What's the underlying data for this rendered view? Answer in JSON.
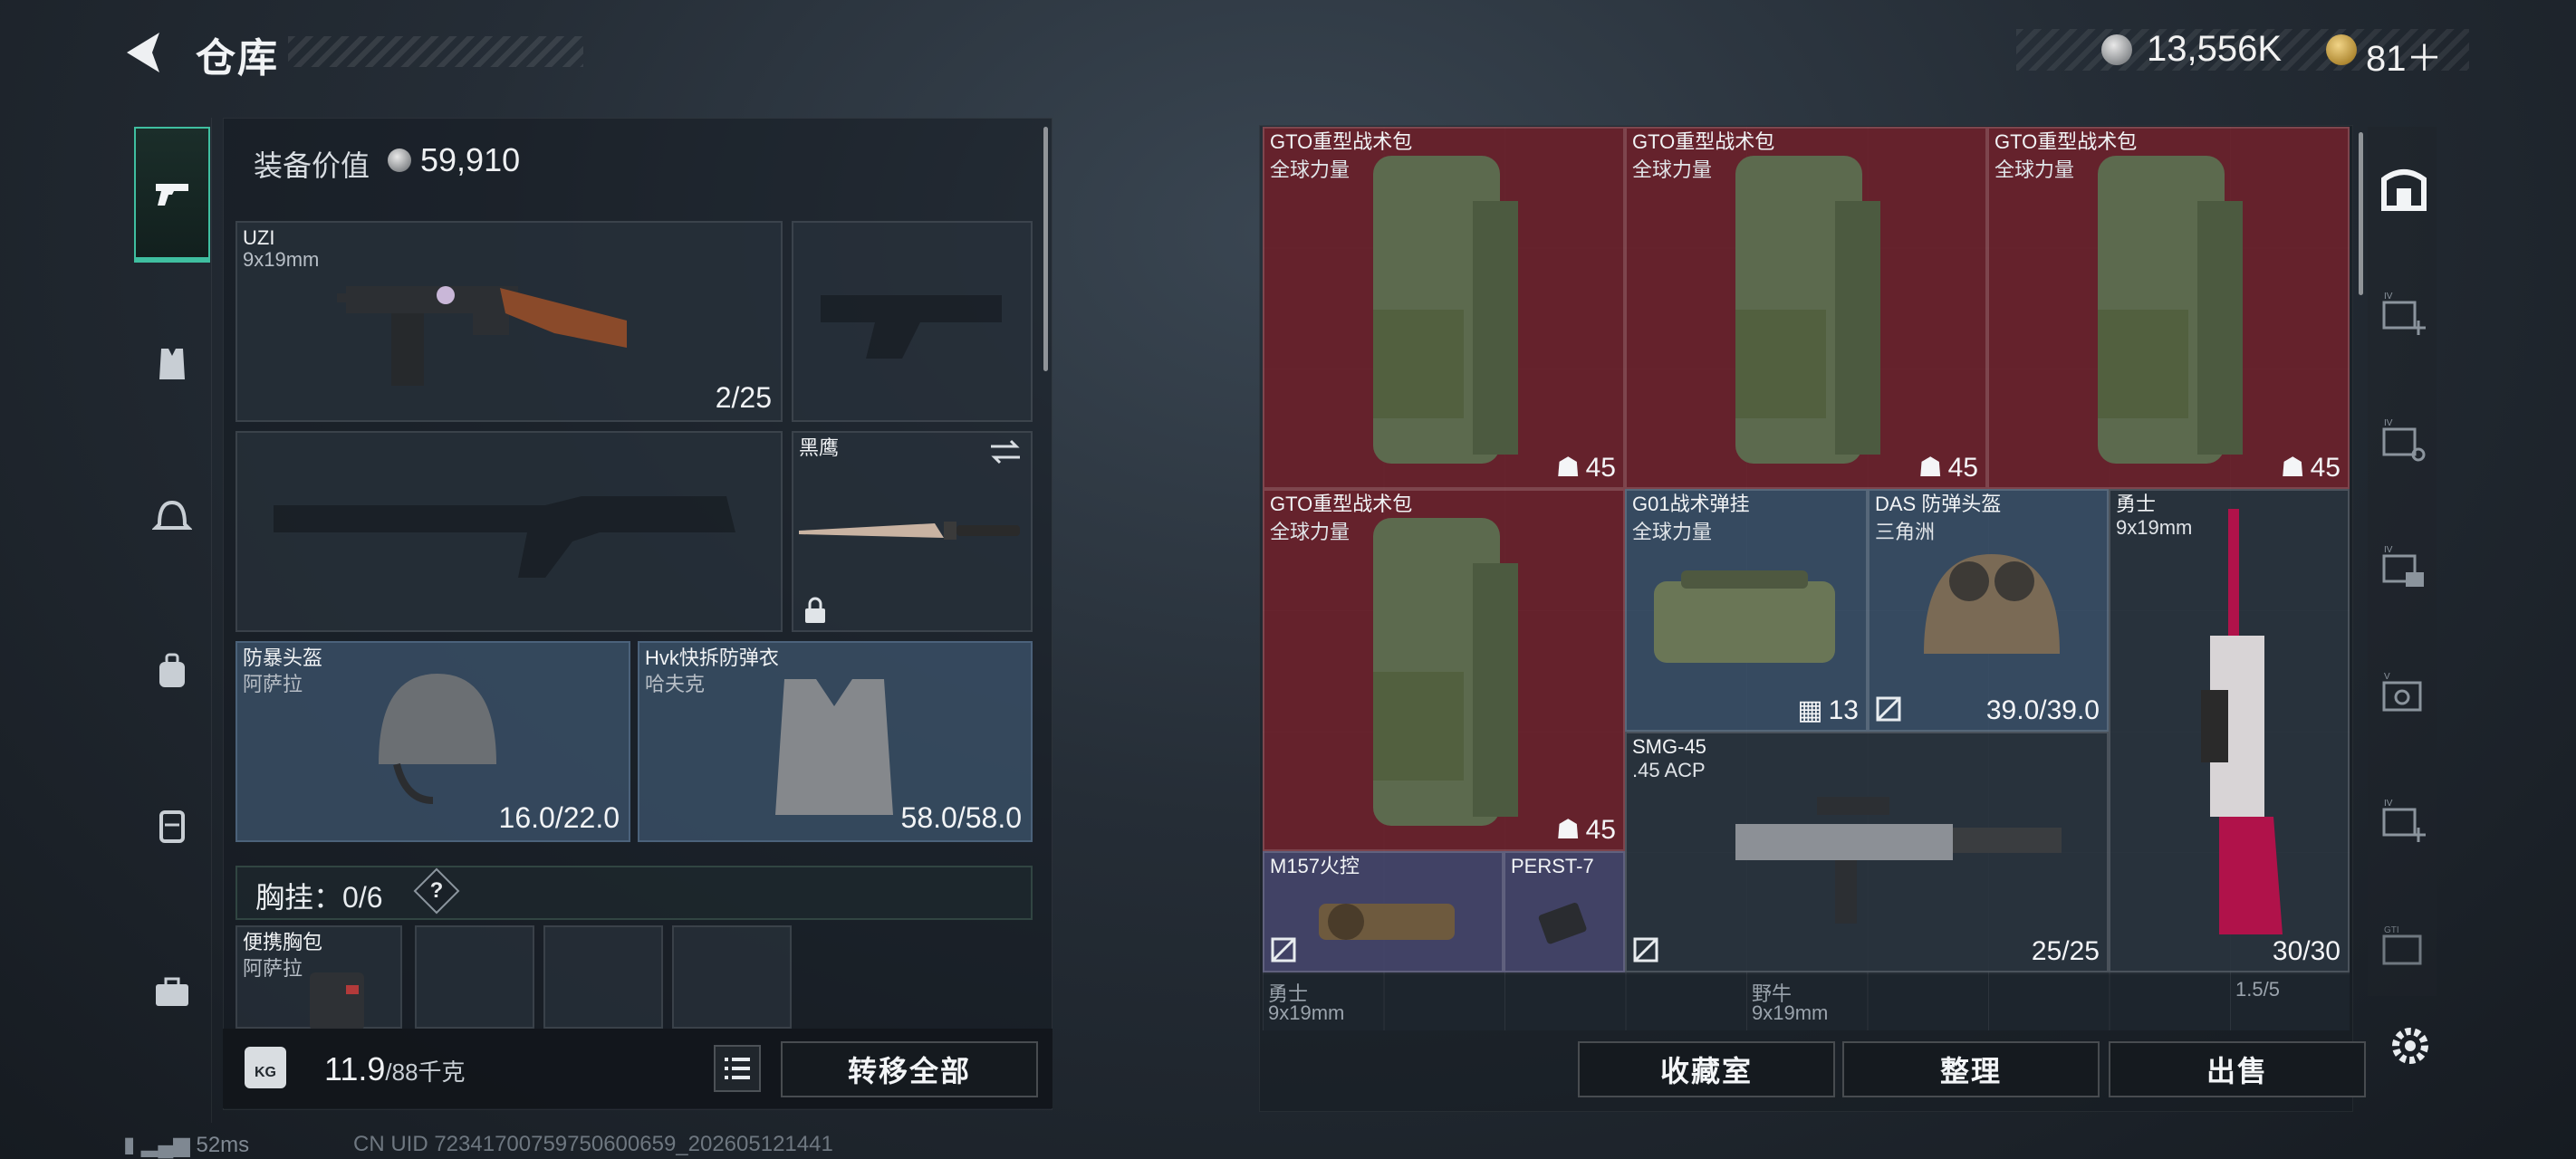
{
  "header": {
    "title": "仓库",
    "money": "13,556K",
    "tickets": "81＋"
  },
  "left_rail": [
    "pistol-tab",
    "vest-tab",
    "helmet-tab",
    "backpack-tab",
    "rig-tab",
    "case-tab"
  ],
  "loadout": {
    "value_label": "装备价值",
    "value": "59,910",
    "primary": {
      "name": "UZI",
      "caliber": "9x19mm",
      "ammo": "2/25"
    },
    "melee": {
      "name": "黑鹰"
    },
    "helmet": {
      "name": "防暴头盔",
      "sub": "阿萨拉",
      "durability": "16.0/22.0"
    },
    "armor": {
      "name": "Hvk快拆防弹衣",
      "sub": "哈夫克",
      "durability": "58.0/58.0"
    },
    "chest_rig": {
      "label": "胸挂：",
      "count": "0/6",
      "help": "?"
    },
    "pouch": {
      "name": "便携胸包",
      "sub": "阿萨拉"
    },
    "weight": "11.9",
    "weight_max": "/88千克",
    "kg_label": "KG",
    "transfer_all": "转移全部"
  },
  "stash": {
    "items": [
      {
        "id": "gto1",
        "name": "GTO重型战术包",
        "sub": "全球力量",
        "value": "45"
      },
      {
        "id": "gto2",
        "name": "GTO重型战术包",
        "sub": "全球力量",
        "value": "45"
      },
      {
        "id": "gto3",
        "name": "GTO重型战术包",
        "sub": "全球力量",
        "value": "45"
      },
      {
        "id": "gto4",
        "name": "GTO重型战术包",
        "sub": "全球力量",
        "value": "45"
      },
      {
        "id": "g01",
        "name": "G01战术弹挂",
        "sub": "全球力量",
        "value": "13"
      },
      {
        "id": "das",
        "name": "DAS 防弹头盔",
        "sub": "三角洲",
        "value": "39.0/39.0"
      },
      {
        "id": "warrior",
        "name": "勇士",
        "sub": "9x19mm",
        "value": "30/30"
      },
      {
        "id": "smg45",
        "name": "SMG-45",
        "sub": ".45 ACP",
        "value": "25/25"
      },
      {
        "id": "m157",
        "name": "M157火控",
        "sub": "",
        "value": ""
      },
      {
        "id": "perst",
        "name": "PERST-7",
        "sub": "",
        "value": ""
      }
    ],
    "bottom_row": [
      {
        "name": "勇士",
        "sub": "9x19mm"
      },
      {
        "name": "野牛",
        "sub": "9x19mm"
      },
      {
        "name": "",
        "sub": "1.5/5"
      }
    ],
    "buttons": {
      "collection": "收藏室",
      "sort": "整理",
      "sell": "出售"
    }
  },
  "right_rail": [
    "safebox-icon",
    "add-slot-icon",
    "key-slot-icon",
    "card-slot-icon",
    "tool-slot-icon",
    "add-slot-icon-2",
    "gti-slot-icon"
  ],
  "status": {
    "ping": "52ms",
    "uid": "CN UID 72341700759750600659_202605121441"
  },
  "colors": {
    "accent": "#3fbfa0",
    "red_rarity": "#70222c",
    "blue_rarity": "#3a5068",
    "purple_rarity": "#46466c"
  }
}
